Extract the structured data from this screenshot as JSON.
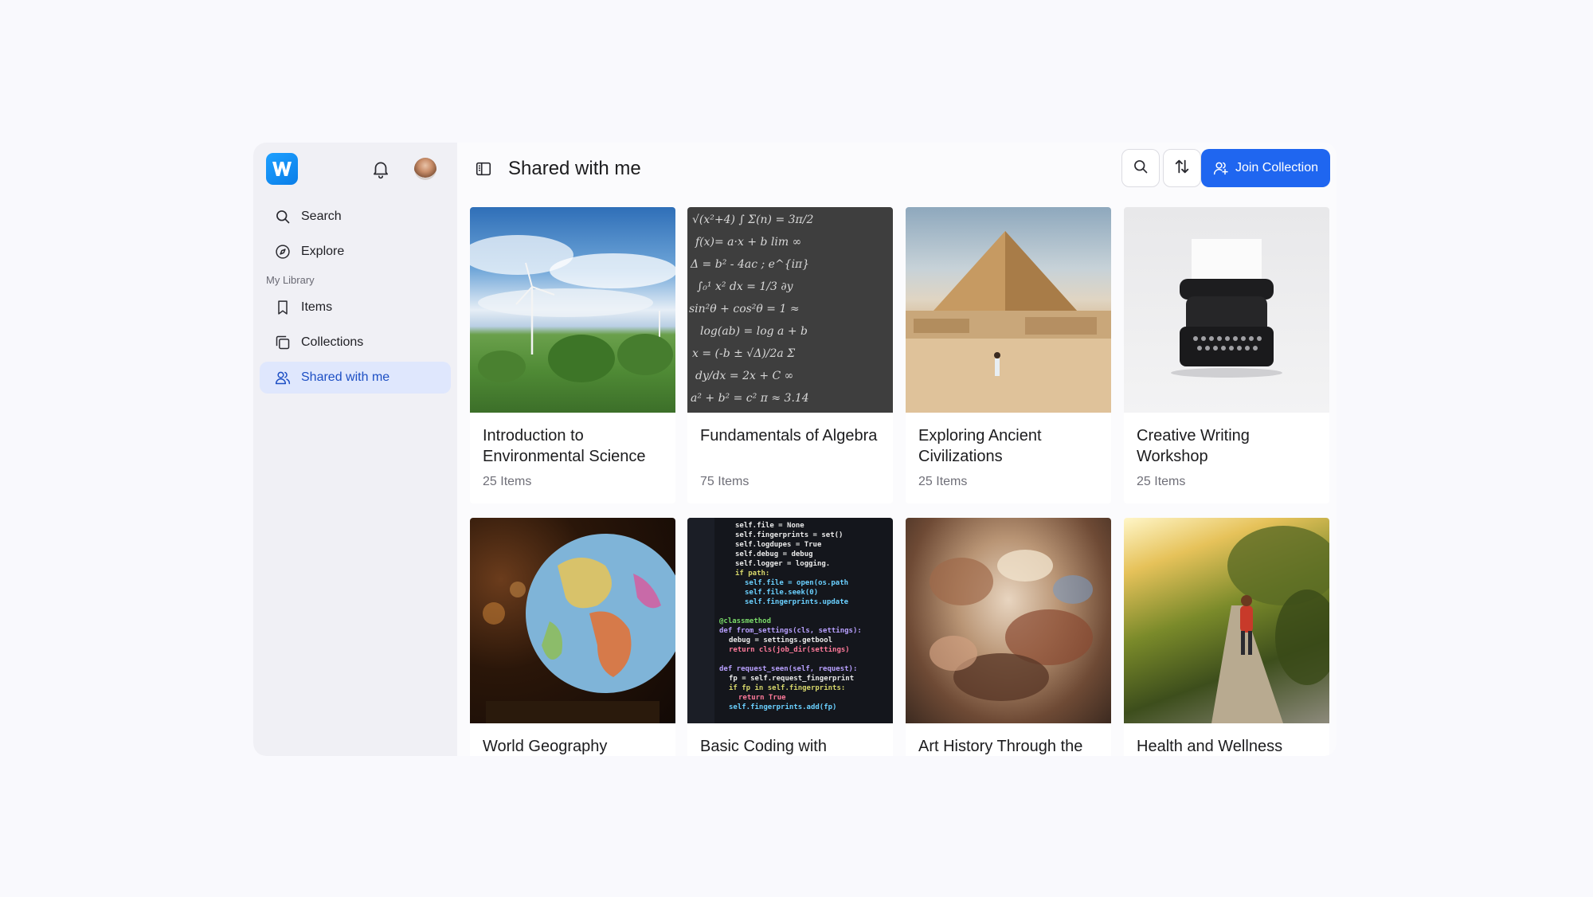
{
  "sidebar": {
    "items": [
      {
        "label": "Search",
        "icon": "search-icon"
      },
      {
        "label": "Explore",
        "icon": "compass-icon"
      },
      {
        "label": "Items",
        "icon": "bookmark-icon"
      },
      {
        "label": "Collections",
        "icon": "collections-icon"
      },
      {
        "label": "Shared with me",
        "icon": "users-icon",
        "active": true
      }
    ],
    "section_label": "My Library"
  },
  "header": {
    "title": "Shared with me",
    "join_label": "Join Collection"
  },
  "colors": {
    "accent": "#1f66f0",
    "active_bg": "#dfe7fd",
    "active_text": "#1d4fc4"
  },
  "cards": [
    {
      "title": "Introduction to Environmental Science",
      "count": "25 Items",
      "image": "wind-turbines"
    },
    {
      "title": "Fundamentals of Algebra",
      "count": "75 Items",
      "image": "chalkboard-equations"
    },
    {
      "title": "Exploring Ancient Civilizations",
      "count": "25 Items",
      "image": "pyramid"
    },
    {
      "title": "Creative Writing Workshop",
      "count": "25 Items",
      "image": "typewriter"
    },
    {
      "title": "World Geography",
      "count": "",
      "image": "globe"
    },
    {
      "title": "Basic Coding with",
      "count": "",
      "image": "code-screen"
    },
    {
      "title": "Art History Through the",
      "count": "",
      "image": "baroque-painting"
    },
    {
      "title": "Health and Wellness",
      "count": "",
      "image": "park-runner"
    }
  ]
}
